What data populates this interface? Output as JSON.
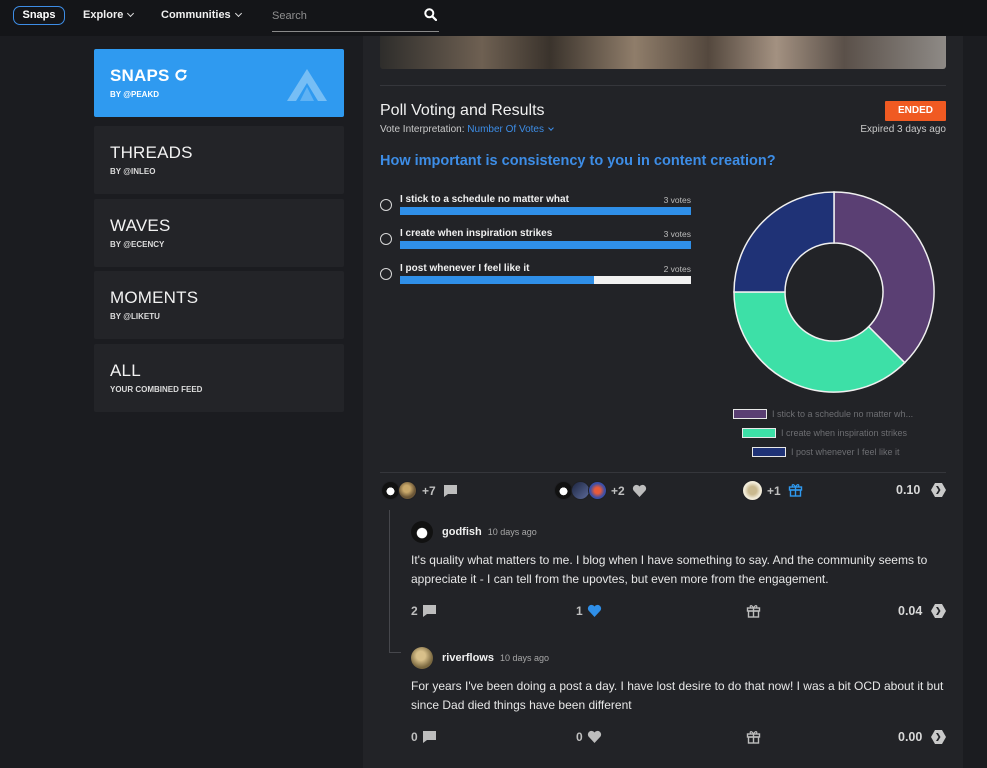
{
  "nav": {
    "home": "Snaps",
    "explore": "Explore",
    "communities": "Communities",
    "search_placeholder": "Search"
  },
  "sidebar": {
    "items": [
      {
        "title": "SNAPS",
        "sub": "BY @PEAKD",
        "active": true
      },
      {
        "title": "THREADS",
        "sub": "BY @INLEO"
      },
      {
        "title": "WAVES",
        "sub": "BY @ECENCY"
      },
      {
        "title": "MOMENTS",
        "sub": "BY @LIKETU"
      },
      {
        "title": "ALL",
        "sub": "YOUR COMBINED FEED"
      }
    ]
  },
  "poll": {
    "heading": "Poll Voting and Results",
    "status": "ENDED",
    "interp_label": "Vote Interpretation:",
    "interp_value": "Number Of Votes",
    "expired": "Expired 3 days ago",
    "question": "How important is consistency to you in content creation?",
    "options": [
      {
        "label": "I stick to a schedule no matter what",
        "votes": "3 votes",
        "fill": 1.0
      },
      {
        "label": "I create when inspiration strikes",
        "votes": "3 votes",
        "fill": 1.0
      },
      {
        "label": "I post whenever I feel like it",
        "votes": "2 votes",
        "fill": 0.667
      }
    ],
    "legend": [
      "I stick to a schedule no matter wh...",
      "I create when inspiration strikes",
      "I post whenever I feel like it"
    ]
  },
  "chart_data": {
    "type": "pie",
    "categories": [
      "I stick to a schedule no matter what",
      "I create when inspiration strikes",
      "I post whenever I feel like it"
    ],
    "values": [
      3,
      3,
      2
    ],
    "colors": [
      "#5a3f73",
      "#3de0a7",
      "#1f3276"
    ],
    "donut": true,
    "legend_position": "bottom-right"
  },
  "post_stats": {
    "comments": "+7",
    "votes": "+2",
    "tips": "+1",
    "payout": "0.10"
  },
  "replies": [
    {
      "user": "godfish",
      "time": "10 days ago",
      "body": "It's quality what matters to me. I blog when I have something to say. And the community seems to appreciate it - I can tell from the upovtes, but even more from the engagement.",
      "comments": "2",
      "votes": "1",
      "payout": "0.04"
    },
    {
      "user": "riverflows",
      "time": "10 days ago",
      "body": "For years I've been doing a post a day. I have lost desire to do that now! I was a bit OCD about it but since Dad died things have been different",
      "comments": "0",
      "votes": "0",
      "payout": "0.00"
    }
  ],
  "colors": {
    "accent": "#2f9af0",
    "link": "#3d8de6",
    "ended": "#f05a22",
    "like": "#2f8fe8"
  }
}
